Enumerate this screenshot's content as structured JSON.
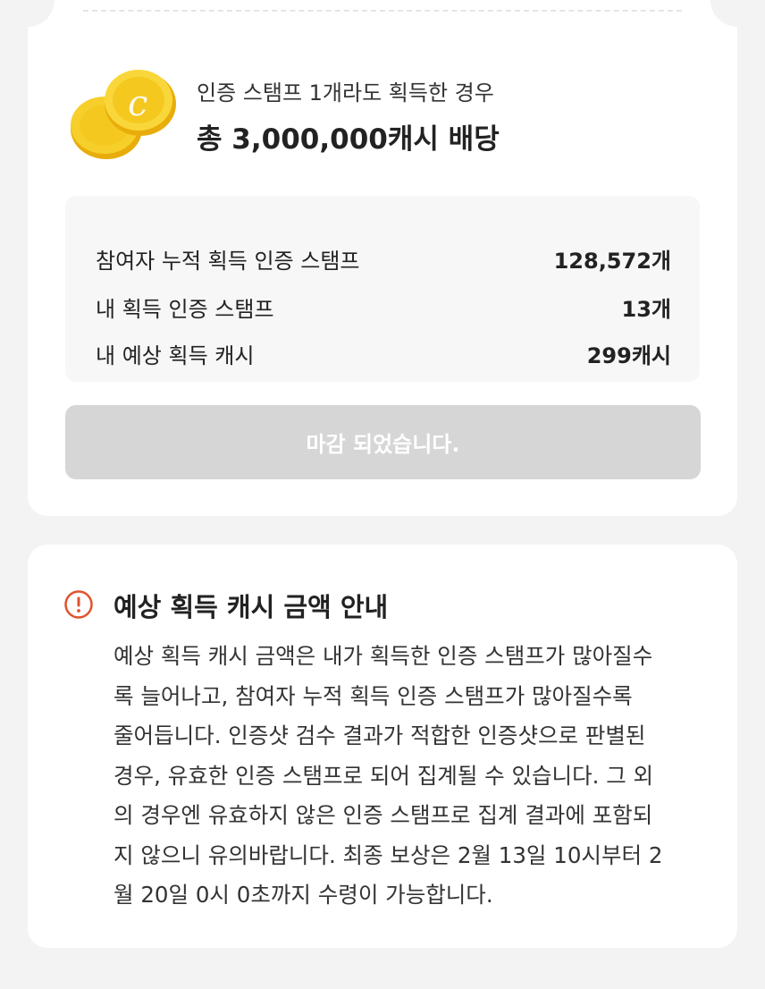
{
  "promo": {
    "subtitle": "인증 스탬프 1개라도 획득한 경우",
    "title": "총 3,000,000캐시 배당",
    "coin_icon": "coin-icon"
  },
  "stats": [
    {
      "label": "참여자 누적 획득 인증 스탬프",
      "value": "128,572개"
    },
    {
      "label": "내 획득 인증 스탬프",
      "value": "13개"
    },
    {
      "label": "내 예상 획득 캐시",
      "value": "299캐시"
    }
  ],
  "closed_button": {
    "label": "마감 되었습니다."
  },
  "info": {
    "icon": "alert-circle-icon",
    "title": "예상 획득 캐시 금액 안내",
    "body_lines": [
      "예상 획득 캐시 금액은 내가 획득한 인증 스탬프가 많아질수",
      "록 늘어나고, 참여자 누적 획득 인증 스탬프가 많아질수록",
      "줄어듭니다. 인증샷 검수 결과가 적합한 인증샷으로 판별된",
      "경우, 유효한 인증 스탬프로 되어 집계될 수 있습니다. 그 외",
      "의 경우엔 유효하지 않은 인증 스탬프로 집계 결과에 포함되",
      "지 않으니 유의바랍니다. 최종 보상은 2월 13일 10시부터 2",
      "월 20일 0시 0초까지 수령이 가능합니다."
    ]
  },
  "colors": {
    "background": "#f3f3f4",
    "card": "#ffffff",
    "coin": "#f5c518",
    "alert": "#e0532d",
    "disabled_button": "#d6d6d6"
  }
}
